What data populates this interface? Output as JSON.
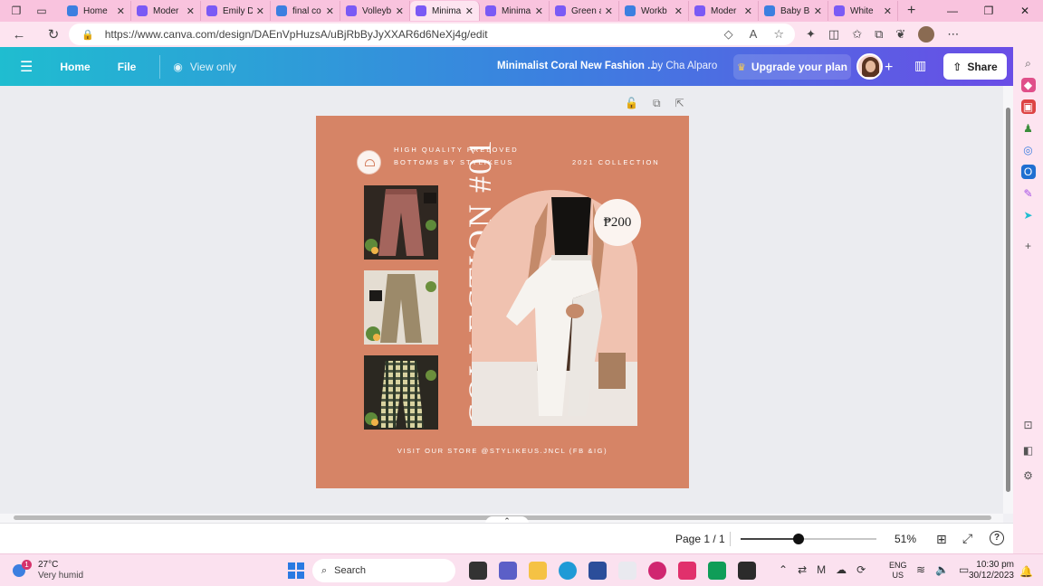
{
  "browser": {
    "tabs": [
      {
        "title": "Home",
        "color": "#3c7fe0",
        "active": false
      },
      {
        "title": "Moder",
        "color": "#7a5af5",
        "active": false
      },
      {
        "title": "Emily D",
        "color": "#7a5af5",
        "active": false
      },
      {
        "title": "final co",
        "color": "#3c7fe0",
        "active": false
      },
      {
        "title": "Volleyb",
        "color": "#7a5af5",
        "active": false
      },
      {
        "title": "Minima",
        "color": "#7a5af5",
        "active": true
      },
      {
        "title": "Minima",
        "color": "#7a5af5",
        "active": false
      },
      {
        "title": "Green a",
        "color": "#7a5af5",
        "active": false
      },
      {
        "title": "Workb",
        "color": "#3c7fe0",
        "active": false
      },
      {
        "title": "Moder",
        "color": "#7a5af5",
        "active": false
      },
      {
        "title": "Baby B",
        "color": "#3c7fe0",
        "active": false
      },
      {
        "title": "White",
        "color": "#7a5af5",
        "active": false
      }
    ],
    "url": "https://www.canva.com/design/DAEnVpHuzsA/uBjRbByJyXXAR6d6NeXj4g/edit"
  },
  "canva": {
    "home_label": "Home",
    "file_label": "File",
    "view_only_label": "View only",
    "doc_title": "Minimalist Coral New Fashion ...",
    "doc_author": "by Cha Alparo",
    "upgrade_label": "Upgrade your plan",
    "share_label": "Share"
  },
  "design": {
    "tagline_1": "HIGH QUALITY PRELOVED",
    "tagline_2": "BOTTOMS BY STYLIKEUS",
    "collection_year": "2021 COLLECTION",
    "vertical_title": "COLLECTION #01",
    "price": "₱200",
    "footer": "VISIT OUR STORE @STYLIKEUS.JNCL (FB &IG)",
    "bg_color": "#d68466"
  },
  "footer_bar": {
    "page_label": "Page 1 / 1",
    "zoom_label": "51%",
    "zoom_value": 0.51
  },
  "taskbar": {
    "temp": "27°C",
    "weather": "Very humid",
    "badge": "1",
    "search_label": "Search",
    "lang_1": "ENG",
    "lang_2": "US",
    "time": "10:30 pm",
    "date": "30/12/2023"
  }
}
